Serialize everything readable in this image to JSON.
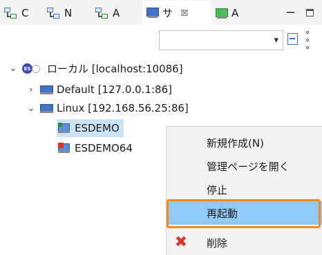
{
  "tabs": [
    {
      "label": "C",
      "icon": "hierarchy-icon"
    },
    {
      "label": "N",
      "icon": "hierarchy-icon"
    },
    {
      "label": "A",
      "icon": "hierarchy-icon"
    },
    {
      "label": "サ",
      "icon": "server-monitor-icon",
      "active": true
    },
    {
      "label": "A",
      "icon": "monitor-green-icon"
    }
  ],
  "tab_close_glyph": "⊠",
  "toolbar": {
    "filter_value": "",
    "dropdown_glyph": "▾"
  },
  "tree": {
    "root": {
      "label": "ローカル [localhost:10086]",
      "icon": "es-globe-icon",
      "expanded": true
    },
    "nodes": [
      {
        "label": "Default [127.0.0.1:86]",
        "expanded": false
      },
      {
        "label": "Linux [192.168.56.25:86]",
        "expanded": true
      }
    ],
    "instances": [
      {
        "label": "ESDEMO",
        "status": "running",
        "selected": true
      },
      {
        "label": "ESDEMO64",
        "status": "stopped",
        "selected": false
      }
    ],
    "expand_glyph": "›",
    "collapse_glyph": "⌄"
  },
  "context_menu": {
    "items": [
      {
        "label": "新規作成(N)"
      },
      {
        "label": "管理ページを開く"
      },
      {
        "label": "停止"
      },
      {
        "label": "再起動",
        "highlighted": true
      },
      {
        "label": "削除",
        "icon": "delete-x-icon"
      }
    ],
    "delete_glyph": "✖"
  },
  "colors": {
    "highlight": "#91c9f7",
    "callout_border": "#f08b1d",
    "selection": "#cce4f7"
  }
}
